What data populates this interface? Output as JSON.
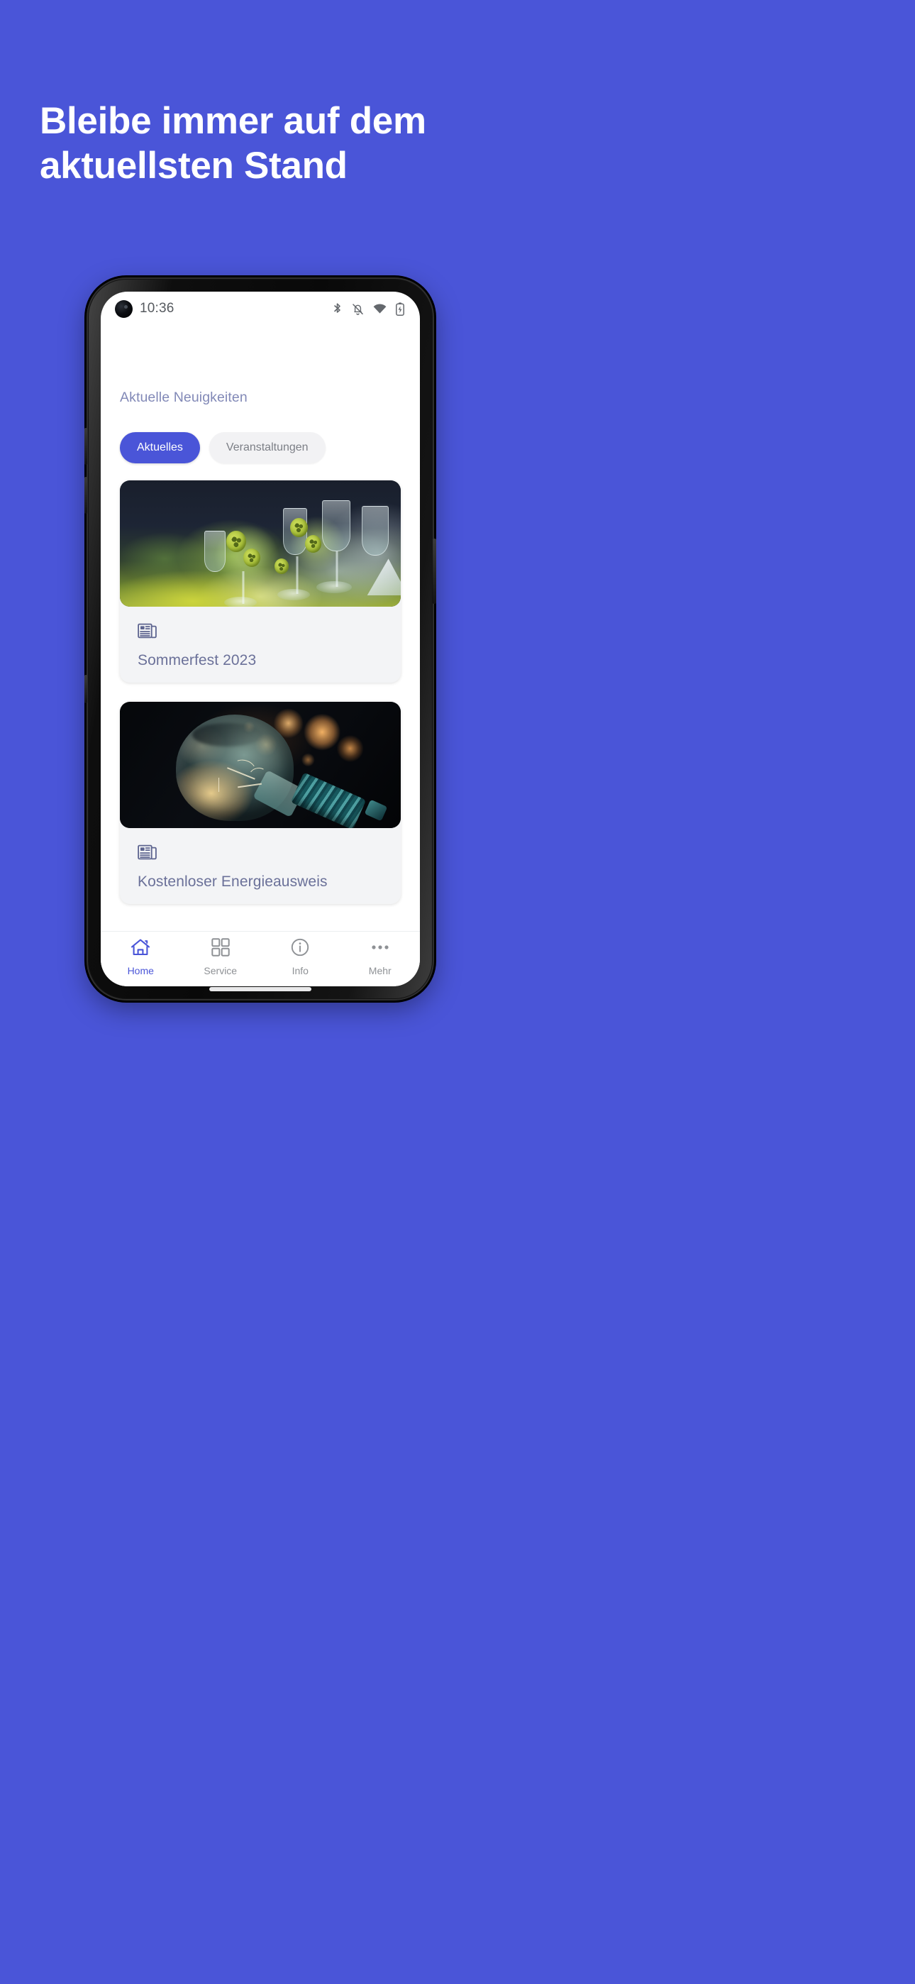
{
  "promo": {
    "headline": "Bleibe immer auf dem\naktuellsten Stand",
    "background_color": "#4a55d8",
    "headline_color": "#ffffff"
  },
  "phone": {
    "status_bar": {
      "time": "10:36",
      "icons": [
        "bluetooth-icon",
        "notifications-off-icon",
        "wifi-icon",
        "battery-charging-icon"
      ]
    },
    "home_indicator": true
  },
  "app": {
    "section_title": "Aktuelle Neuigkeiten",
    "accent_color": "#4a55d8",
    "filters": [
      {
        "label": "Aktuelles",
        "active": true
      },
      {
        "label": "Veranstaltungen",
        "active": false
      }
    ],
    "cards": [
      {
        "title": "Sommerfest 2023",
        "icon": "newspaper-icon",
        "image_alt": "Festlich gedeckter Tisch mit Gläsern und grünen Blumen"
      },
      {
        "title": "Kostenloser Energieausweis",
        "icon": "newspaper-icon",
        "image_alt": "Glühbirne vor orangefarbenem Bokeh-Hintergrund"
      }
    ],
    "bottom_nav": [
      {
        "label": "Home",
        "icon": "home-icon",
        "active": true
      },
      {
        "label": "Service",
        "icon": "grid-icon",
        "active": false
      },
      {
        "label": "Info",
        "icon": "info-circle-icon",
        "active": false
      },
      {
        "label": "Mehr",
        "icon": "more-dots-icon",
        "active": false
      }
    ]
  }
}
